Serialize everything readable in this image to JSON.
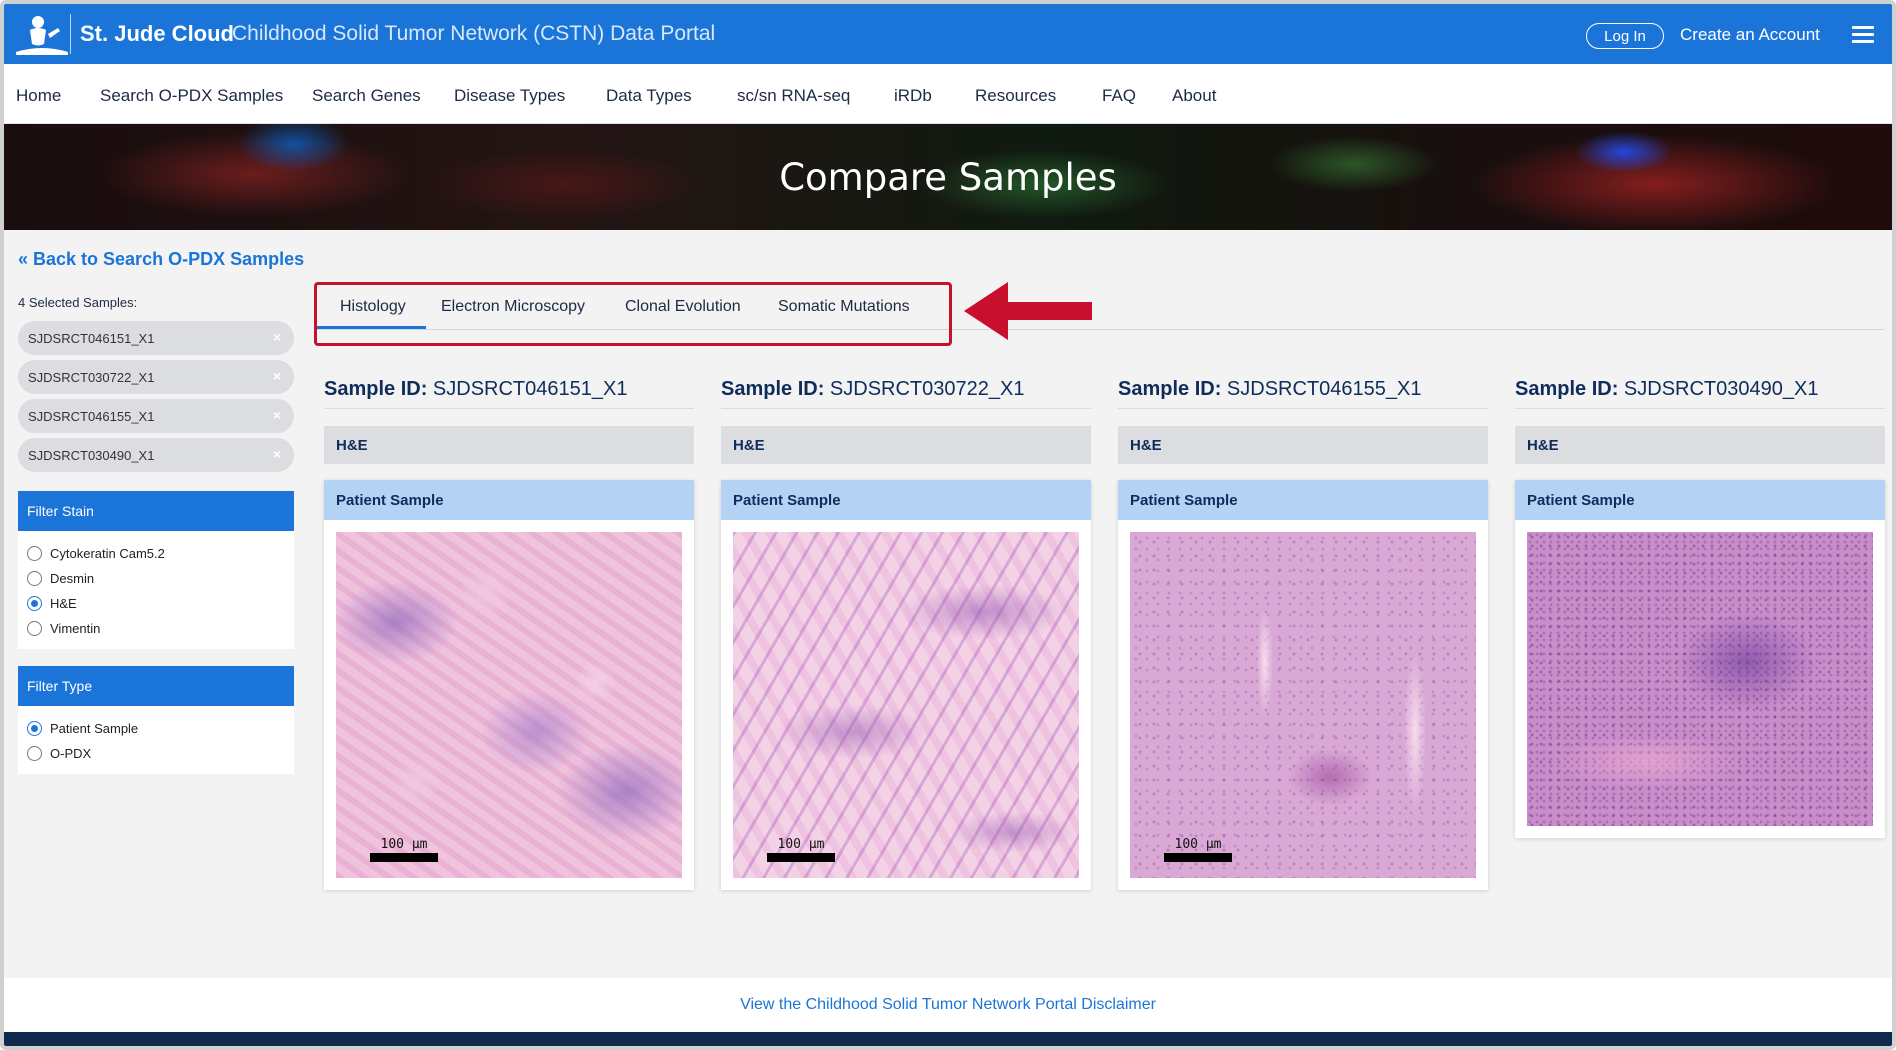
{
  "header": {
    "brand": "St. Jude Cloud",
    "subtitle": "Childhood Solid Tumor Network (CSTN) Data Portal",
    "login_label": "Log In",
    "create_account_label": "Create an Account"
  },
  "nav": {
    "items": [
      "Home",
      "Search O-PDX Samples",
      "Search Genes",
      "Disease Types",
      "Data Types",
      "sc/sn RNA-seq",
      "iRDb",
      "Resources",
      "FAQ",
      "About"
    ]
  },
  "banner": {
    "title": "Compare Samples"
  },
  "back_link": "« Back to Search O-PDX Samples",
  "sidebar": {
    "selected_count_label": "4 Selected Samples:",
    "selected_samples": [
      "SJDSRCT046151_X1",
      "SJDSRCT030722_X1",
      "SJDSRCT046155_X1",
      "SJDSRCT030490_X1"
    ],
    "remove_glyph": "×",
    "filter_stain": {
      "title": "Filter Stain",
      "options": [
        "Cytokeratin Cam5.2",
        "Desmin",
        "H&E",
        "Vimentin"
      ],
      "selected": "H&E"
    },
    "filter_type": {
      "title": "Filter Type",
      "options": [
        "Patient Sample",
        "O-PDX"
      ],
      "selected": "Patient Sample"
    }
  },
  "tabs": {
    "items": [
      "Histology",
      "Electron Microscopy",
      "Clonal Evolution",
      "Somatic Mutations"
    ],
    "active": "Histology"
  },
  "samples": [
    {
      "id_label": "Sample ID:",
      "id": "SJDSRCT046151_X1",
      "stain": "H&E",
      "type": "Patient Sample",
      "scale": "100 µm"
    },
    {
      "id_label": "Sample ID:",
      "id": "SJDSRCT030722_X1",
      "stain": "H&E",
      "type": "Patient Sample",
      "scale": "100 µm"
    },
    {
      "id_label": "Sample ID:",
      "id": "SJDSRCT046155_X1",
      "stain": "H&E",
      "type": "Patient Sample",
      "scale": "100 µm"
    },
    {
      "id_label": "Sample ID:",
      "id": "SJDSRCT030490_X1",
      "stain": "H&E",
      "type": "Patient Sample"
    }
  ],
  "footer": {
    "disclaimer_link": "View the Childhood Solid Tumor Network Portal Disclaimer"
  },
  "colors": {
    "primary": "#1b75d8",
    "highlight_annotation": "#c8102e",
    "navy": "#0f2c5a"
  }
}
